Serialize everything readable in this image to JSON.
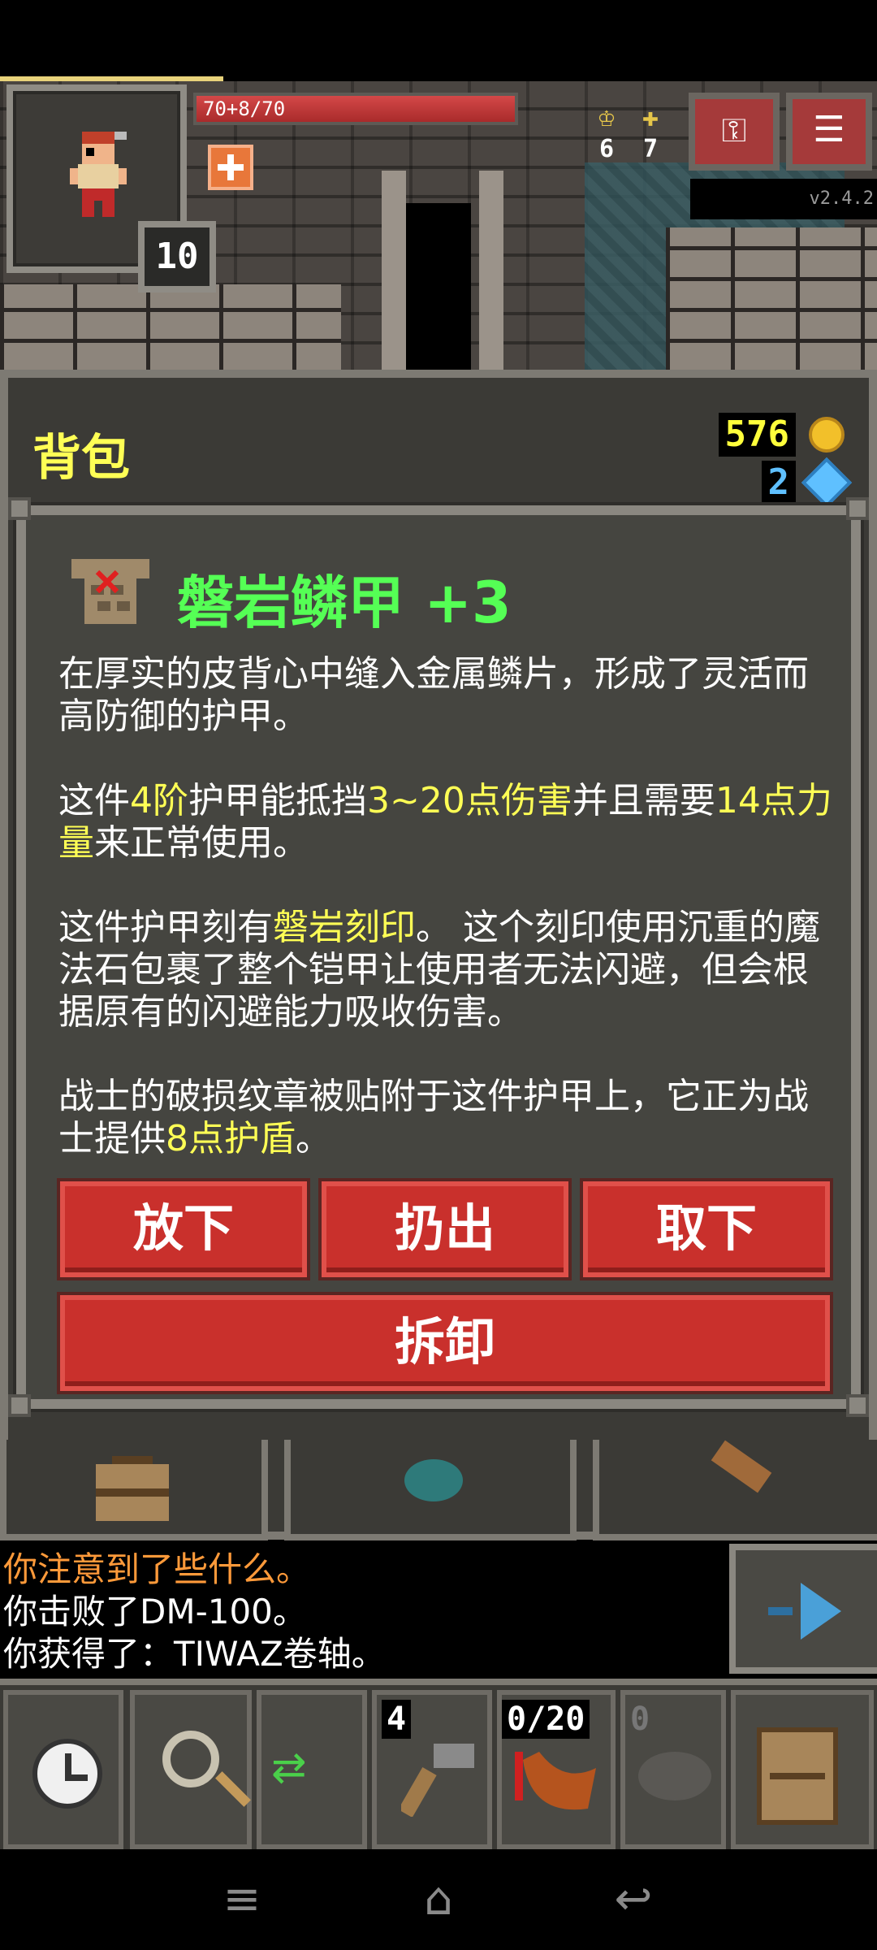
{
  "hud": {
    "hp_text": "70+8/70",
    "hp_fraction": 1.0,
    "hero_level": "10",
    "iron_keys": "6",
    "gold_keys": "7",
    "journal_icon": "keys-journal-icon",
    "menu_icon": "menu-icon",
    "version": "v2.4.2"
  },
  "bag": {
    "title": "背包",
    "gold": "576",
    "gems": "2"
  },
  "item": {
    "icon": "scale-armor-icon",
    "name": "磐岩鳞甲 +3",
    "desc1": "在厚实的皮背心中缝入金属鳞片，形成了灵活而高防御的护甲。",
    "desc2_a": "这件",
    "desc2_tier": "4阶",
    "desc2_b": "护甲能抵挡",
    "desc2_block": "3~20点伤害",
    "desc2_c": "并且需要",
    "desc2_str": "14点力量",
    "desc2_d": "来正常使用。",
    "desc3_a": "这件护甲刻有",
    "desc3_glyph": "磐岩刻印",
    "desc3_b": "。 这个刻印使用沉重的魔法石包裹了整个铠甲让使用者无法闪避，但会根据原有的闪避能力吸收伤害。",
    "desc4_a": "战士的破损纹章被贴附于这件护甲上，它正为战士提供",
    "desc4_shield": "8点护盾",
    "desc4_b": "。"
  },
  "actions": {
    "drop": "放下",
    "throw": "扔出",
    "unequip": "取下",
    "disassemble": "拆卸"
  },
  "log": {
    "line1": "你注意到了些什么。",
    "line2": "你击败了DM-100。",
    "line3": "你获得了：TIWAZ卷轴。"
  },
  "quickslots": {
    "slot1_count": "4",
    "slot2_charge": "0/20",
    "slot3_count": "0"
  },
  "colors": {
    "item_name": "#55ff55",
    "highlight": "#ffff55",
    "button_red": "#c9302c",
    "warning_log": "#ff9a3a"
  }
}
